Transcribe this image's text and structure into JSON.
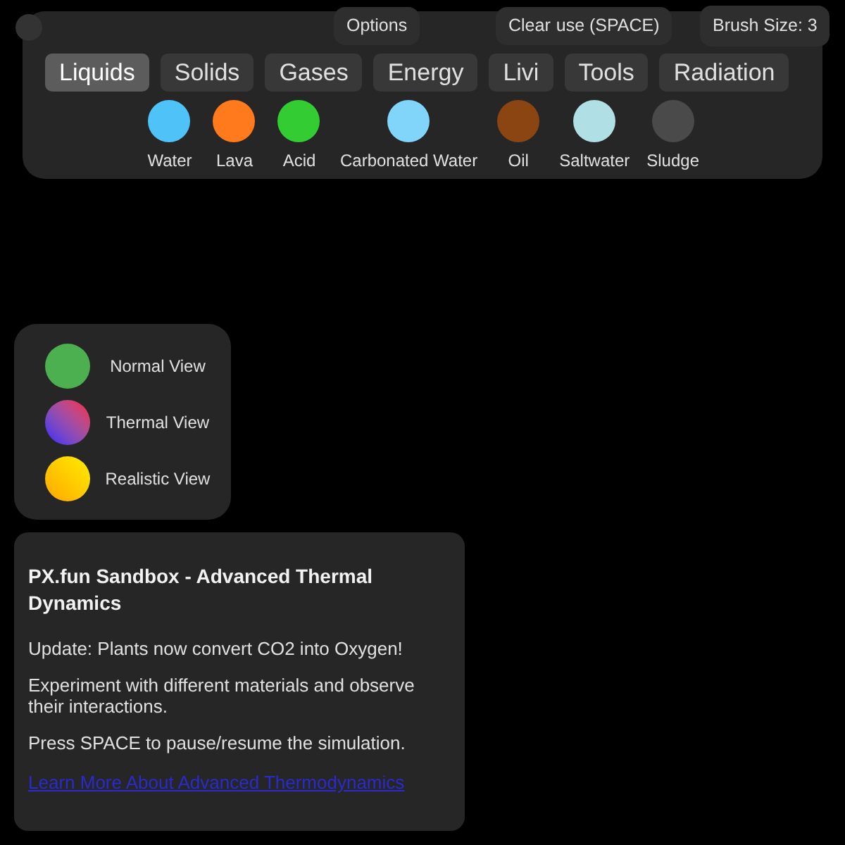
{
  "controls": {
    "options": "Options",
    "clear": "Clear",
    "pause": "use (SPACE)",
    "brush_size": "Brush Size: 3"
  },
  "tabs": [
    {
      "label": "Liquids",
      "selected": true
    },
    {
      "label": "Solids",
      "selected": false
    },
    {
      "label": "Gases",
      "selected": false
    },
    {
      "label": "Energy",
      "selected": false
    },
    {
      "label": "Livi",
      "selected": false
    },
    {
      "label": "Tools",
      "selected": false
    },
    {
      "label": "Radiation",
      "selected": false
    }
  ],
  "materials": [
    {
      "name": "Water",
      "color": "#4fc3f7"
    },
    {
      "name": "Lava",
      "color": "#ff7a1c"
    },
    {
      "name": "Acid",
      "color": "#33cc33"
    },
    {
      "name": "Carbonated Water",
      "color": "#81d4fa"
    },
    {
      "name": "Oil",
      "color": "#8b4513"
    },
    {
      "name": "Saltwater",
      "color": "#b0e0e6"
    },
    {
      "name": "Sludge",
      "color": "#4a4a4a"
    }
  ],
  "views": [
    {
      "label": "Normal View",
      "kind": "normal"
    },
    {
      "label": "Thermal View",
      "kind": "thermal"
    },
    {
      "label": "Realistic View",
      "kind": "realistic"
    }
  ],
  "info": {
    "title": "PX.fun Sandbox - Advanced Thermal Dynamics",
    "paragraphs": [
      "Update: Plants now convert CO2 into Oxygen!",
      "Experiment with different materials and observe their interactions.",
      "Press SPACE to pause/resume the simulation."
    ],
    "link": "Learn More About Advanced Thermodynamics"
  }
}
